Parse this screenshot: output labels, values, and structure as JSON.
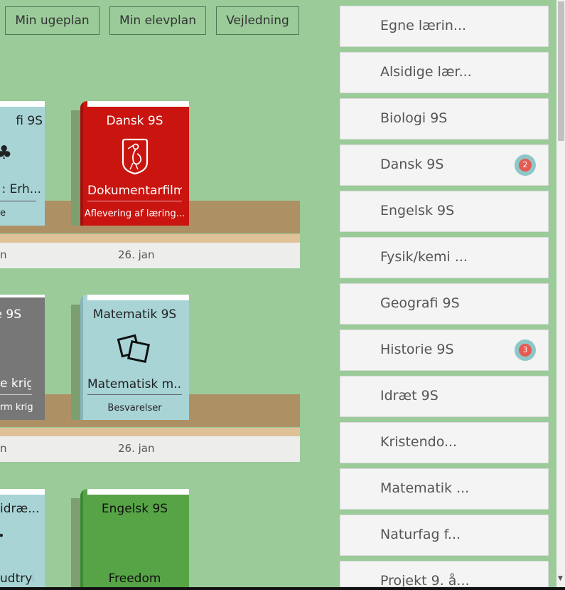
{
  "top_buttons": [
    "Min ugeplan",
    "Min elevplan",
    "Vejledning"
  ],
  "shelves": [
    {
      "dates": [
        "n",
        "26. jan"
      ],
      "books": [
        {
          "title": "fi 9S",
          "subtitle": ": Erh...",
          "small": "e",
          "icon": "club-icon",
          "color": "#a8d4d6"
        },
        {
          "title": "Dansk 9S",
          "subtitle": "Dokumentarfilm",
          "small": "Aflevering af læring...",
          "icon": "stork-logo-icon",
          "color": "#c9140f"
        }
      ]
    },
    {
      "dates": [
        "n",
        "26. jan"
      ],
      "books": [
        {
          "title": "e 9S",
          "subtitle": "e krig",
          "small": "rm krig",
          "icon": "",
          "color": "#777777"
        },
        {
          "title": "Matematik 9S",
          "subtitle": "Matematisk m...",
          "small": "Besvarelser",
          "icon": "squares-icon",
          "color": "#a8d4d6"
        }
      ]
    },
    {
      "books": [
        {
          "title": "idræ...",
          "subtitle": "udtryk",
          "icon": "dot-icon",
          "color": "#a8d4d6"
        },
        {
          "title": "Engelsk 9S",
          "subtitle": "Freedom",
          "icon": "",
          "color": "#57a447"
        }
      ]
    }
  ],
  "sidebar": {
    "items": [
      {
        "label": "Egne lærin..."
      },
      {
        "label": "Alsidige lær..."
      },
      {
        "label": "Biologi 9S"
      },
      {
        "label": "Dansk 9S",
        "badge": "2"
      },
      {
        "label": "Engelsk 9S"
      },
      {
        "label": "Fysik/kemi ..."
      },
      {
        "label": "Geografi 9S"
      },
      {
        "label": "Historie 9S",
        "badge": "3"
      },
      {
        "label": "Idræt 9S"
      },
      {
        "label": "Kristendo..."
      },
      {
        "label": "Matematik ..."
      },
      {
        "label": "Naturfag f..."
      },
      {
        "label": "Projekt 9. å..."
      }
    ]
  }
}
